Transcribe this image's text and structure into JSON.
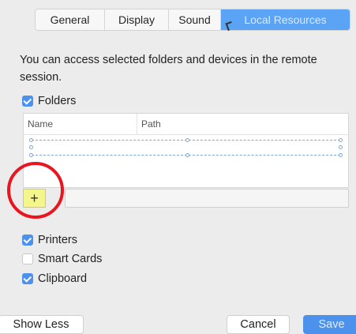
{
  "tabs": [
    {
      "label": "General"
    },
    {
      "label": "Display"
    },
    {
      "label": "Sound"
    },
    {
      "label": "Local Resources",
      "active": true
    }
  ],
  "description": "You can access selected folders and devices in the remote session.",
  "folders": {
    "label": "Folders",
    "checked": true,
    "columns": {
      "name": "Name",
      "path": "Path"
    },
    "add_label": "+"
  },
  "devices": [
    {
      "label": "Printers",
      "checked": true
    },
    {
      "label": "Smart Cards",
      "checked": false
    },
    {
      "label": "Clipboard",
      "checked": true
    }
  ],
  "buttons": {
    "show_less": "Show Less",
    "cancel": "Cancel",
    "save": "Save"
  },
  "colors": {
    "accent": "#4c92ec",
    "highlight": "#f4f58a",
    "annotation": "#e8161e"
  }
}
